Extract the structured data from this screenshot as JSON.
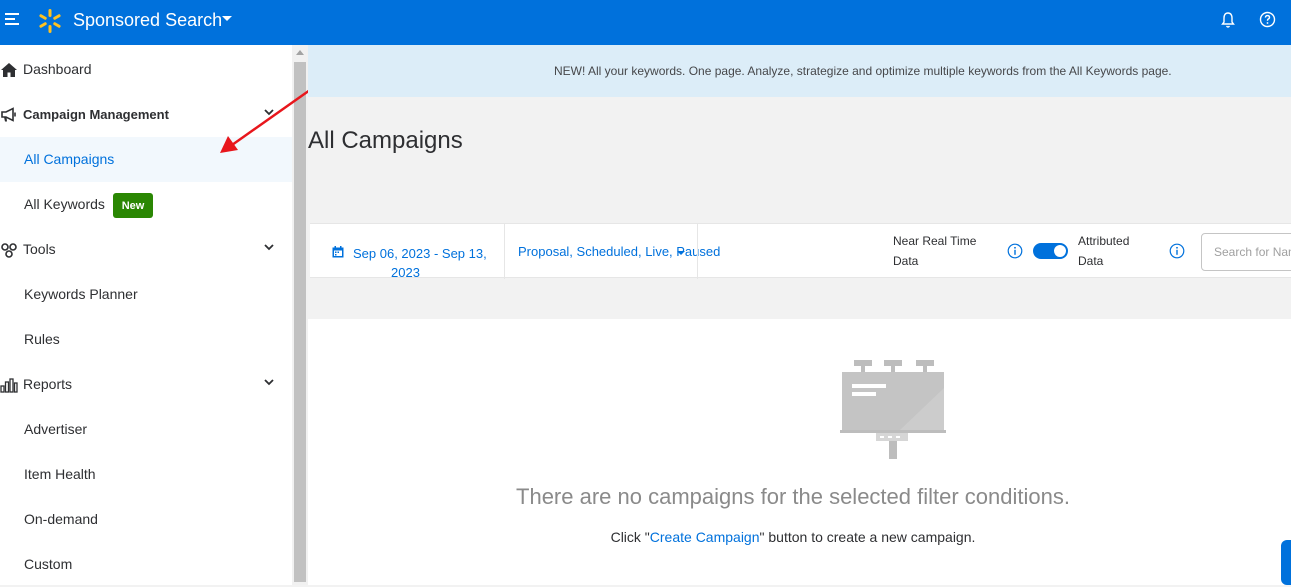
{
  "header": {
    "title": "Sponsored Search",
    "accent": "#0071dc",
    "logo_color": "#ffc220",
    "icons": [
      "menu-icon",
      "spark-logo",
      "bell-icon",
      "help-icon"
    ]
  },
  "sidebar": {
    "items": [
      {
        "label": "Dashboard",
        "icon": "home-icon"
      },
      {
        "label": "Campaign Management",
        "icon": "megaphone-icon",
        "expanded": true
      },
      {
        "label": "All Campaigns",
        "active": true
      },
      {
        "label": "All Keywords",
        "badge": "New"
      },
      {
        "label": "Tools",
        "icon": "tools-icon",
        "expanded": true
      },
      {
        "label": "Keywords Planner"
      },
      {
        "label": "Rules"
      },
      {
        "label": "Reports",
        "icon": "bar-chart-icon",
        "expanded": true
      },
      {
        "label": "Advertiser"
      },
      {
        "label": "Item Health"
      },
      {
        "label": "On-demand"
      },
      {
        "label": "Custom"
      }
    ]
  },
  "banner": {
    "text": "NEW! All your keywords. One page. Analyze, strategize and optimize multiple keywords from the All Keywords page."
  },
  "main": {
    "title": "All Campaigns",
    "filters": {
      "date_line1": "Sep 06, 2023 - Sep 13,",
      "date_line2": "2023",
      "status": "Proposal, Scheduled, Live, Paused",
      "near_real_time_line1": "Near Real Time",
      "near_real_time_line2": "Data",
      "attributed_line1": "Attributed",
      "attributed_line2": "Data",
      "toggle_on": true,
      "search_placeholder": "Search for Name"
    },
    "empty_state": {
      "title": "There are no campaigns for the selected filter conditions.",
      "sub_prefix": "Click \"",
      "sub_link": "Create Campaign",
      "sub_suffix": "\" button to create a new campaign."
    }
  }
}
